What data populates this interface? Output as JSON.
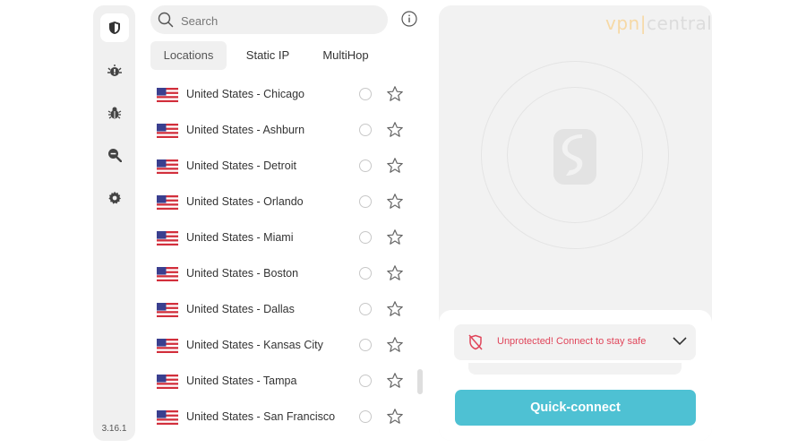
{
  "app": {
    "version": "3.16.1"
  },
  "sidebar": {
    "items": [
      {
        "icon": "shield-icon",
        "active": true
      },
      {
        "icon": "alert-bug-icon",
        "active": false
      },
      {
        "icon": "bug-icon",
        "active": false
      },
      {
        "icon": "search-minus-icon",
        "active": false
      },
      {
        "icon": "gear-icon",
        "active": false
      }
    ]
  },
  "search": {
    "placeholder": "Search",
    "value": ""
  },
  "info_icon": "info-icon",
  "tabs": [
    {
      "label": "Locations",
      "active": true
    },
    {
      "label": "Static IP",
      "active": false
    },
    {
      "label": "MultiHop",
      "active": false
    }
  ],
  "locations": [
    {
      "name": "United States - Chicago"
    },
    {
      "name": "United States - Ashburn"
    },
    {
      "name": "United States - Detroit"
    },
    {
      "name": "United States - Orlando"
    },
    {
      "name": "United States - Miami"
    },
    {
      "name": "United States - Boston"
    },
    {
      "name": "United States - Dallas"
    },
    {
      "name": "United States - Kansas City"
    },
    {
      "name": "United States - Tampa"
    },
    {
      "name": "United States - San Francisco"
    }
  ],
  "watermark": {
    "vpn": "vpn",
    "sep": "|",
    "central": "central"
  },
  "status": {
    "text": "Unprotected! Connect to stay safe",
    "color": "#e0455a"
  },
  "quick_connect": {
    "label": "Quick-connect",
    "color": "#4ec1d3"
  }
}
